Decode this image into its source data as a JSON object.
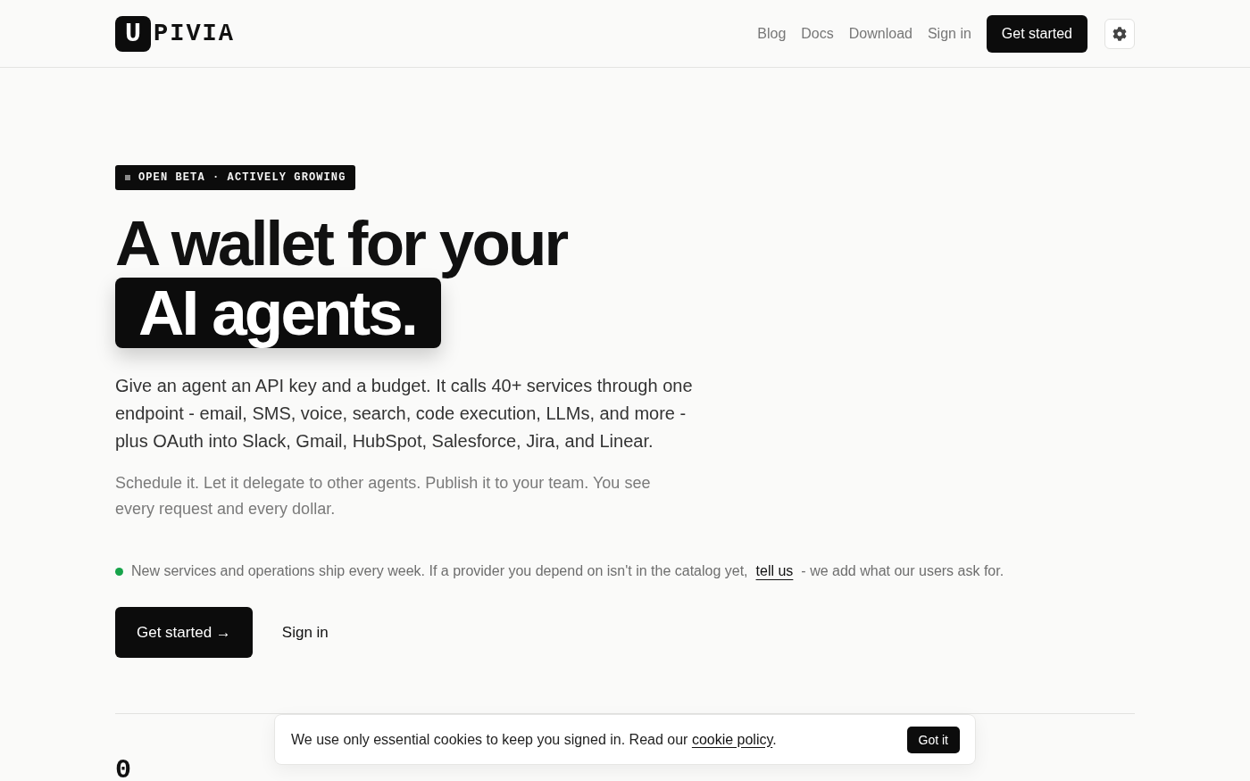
{
  "header": {
    "logo": {
      "mark": "U",
      "text": "PIVIA"
    },
    "nav": [
      {
        "label": "Blog"
      },
      {
        "label": "Docs"
      },
      {
        "label": "Download"
      },
      {
        "label": "Sign in"
      }
    ],
    "cta": "Get started"
  },
  "hero": {
    "badge": "OPEN BETA · ACTIVELY GROWING",
    "title": "A wallet for your",
    "title_highlight": "AI agents.",
    "lead": "Give an agent an API key and a budget. It calls 40+ services through one endpoint - email, SMS, voice, search, code execution, LLMs, and more - plus OAuth into Slack, Gmail, HubSpot, Salesforce, Jira, and Linear.",
    "sub": "Schedule it. Let it delegate to other agents. Publish it to your team. You see every request and every dollar.",
    "notice": {
      "before": "New services and operations ship every week. If a provider you depend on isn't in the catalog yet,",
      "link": "tell us",
      "after": "- we add what our users ask for."
    },
    "buttons": [
      {
        "label": "Get started →",
        "kind": "primary"
      },
      {
        "label": "Sign in",
        "kind": "secondary"
      }
    ]
  },
  "stats": [
    {
      "value": "0"
    }
  ],
  "cookie_banner": {
    "text": "We use only essential cookies to keep you signed in. Read our",
    "link": "cookie policy",
    "after": ".",
    "button": "Got it"
  }
}
